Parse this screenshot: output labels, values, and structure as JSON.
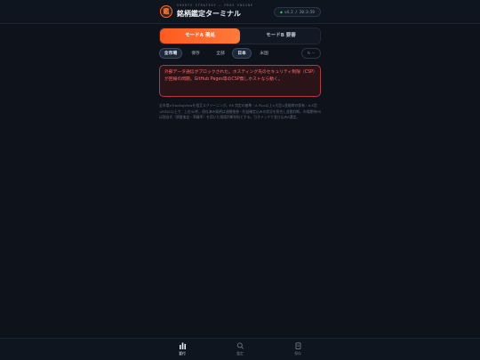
{
  "header": {
    "logo_char": "鑑",
    "subtitle": "SHORTS STRATEGY — PROS ENGINE",
    "title": "銘柄鑑定ターミナル",
    "version": "v4.2 / 20:3:59",
    "status_dot": "●"
  },
  "mode": {
    "a_label": "モードA 現処",
    "b_label": "モードB 要審"
  },
  "filters": {
    "chips": [
      "全市場",
      "保存",
      "全部",
      "日本",
      "米国"
    ],
    "refresh_label": "↻ --"
  },
  "error": {
    "message": "外部データ通信がブロックされた。ホスティング先のセキュリティ制限（CSP）が回線の問題。GitHub Pages等のCSP無しホストなら動く。"
  },
  "description": "全市場×TradingViewを相互スクリーニング。RS 判定の基準・A Plus以上×大型≒並能時の保有・A-S型≒RS61以上で、上位40件。保存済み銘柄は週間推移・利益確定込みの状況を照合し並動判断。市場期待RSは独自式（調整後益・乖離率）を用いた相場判断材料とする。引きメッチで並び込みA選定。",
  "nav": {
    "items": [
      "要付",
      "鑑定",
      "保存"
    ]
  },
  "colors": {
    "accent": "#ff6a2a",
    "error": "#ff6b6b",
    "background": "#0d121b"
  }
}
